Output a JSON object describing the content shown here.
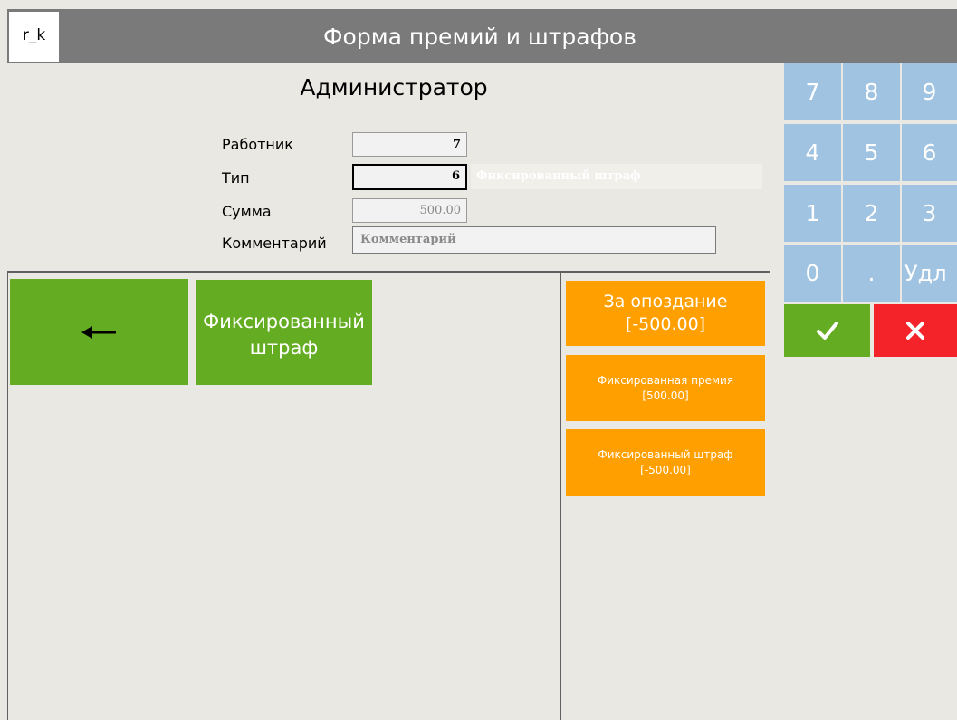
{
  "header": {
    "logo": "r_k",
    "title": "Форма премий и штрафов"
  },
  "user_name": "Администратор",
  "form": {
    "employee_label": "Работник",
    "employee_value": "7",
    "type_label": "Тип",
    "type_value": "6",
    "type_name": "Фиксированный штраф",
    "amount_label": "Сумма",
    "amount_value": "500.00",
    "comment_label": "Комментарий",
    "comment_placeholder": "Комментарий"
  },
  "left_panel": {
    "back_icon": "arrow-left-icon",
    "type_button_label": "Фиксированный штраф"
  },
  "right_panel": {
    "items": [
      {
        "label": "За опоздание",
        "amount": "[-500.00]"
      },
      {
        "label": "Фиксированная премия",
        "amount": "[500.00]"
      },
      {
        "label": "Фиксированный штраф",
        "amount": "[-500.00]"
      }
    ]
  },
  "keypad": {
    "keys": [
      "7",
      "8",
      "9",
      "4",
      "5",
      "6",
      "1",
      "2",
      "3",
      "0",
      ".",
      "Удл"
    ],
    "ok_icon": "checkmark-icon",
    "cancel_icon": "close-icon"
  },
  "colors": {
    "header_bg": "#7a7a7a",
    "green": "#64ad22",
    "orange": "#ffa000",
    "keypad": "#9fc3e1",
    "red": "#f4232a",
    "background": "#e9e8e2"
  }
}
